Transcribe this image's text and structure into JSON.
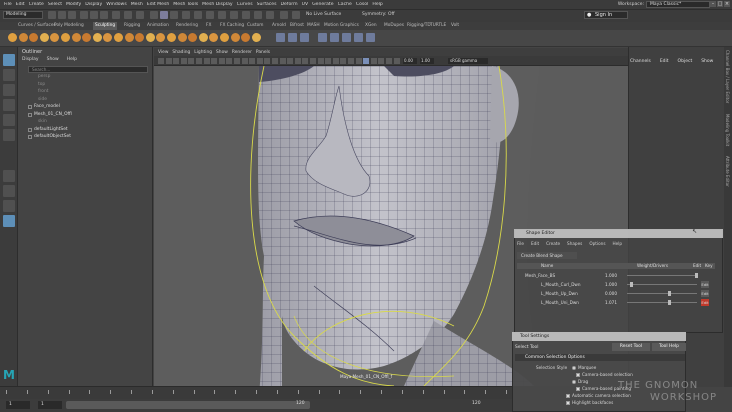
{
  "menubar": {
    "items": [
      "File",
      "Edit",
      "Create",
      "Select",
      "Modify",
      "Display",
      "Windows",
      "Mesh",
      "Edit Mesh",
      "Mesh Tools",
      "Mesh Display",
      "Curves",
      "Surfaces",
      "Deform",
      "UV",
      "Generate",
      "Cache",
      "Cosol",
      "Help"
    ],
    "workspace_label": "Workspace:",
    "workspace_value": "Maya Classic*"
  },
  "statusline": {
    "mode": "Modeling",
    "no_live": "No Live Surface",
    "symmetry": "Symmetry: Off",
    "sign_in": "Sign In"
  },
  "shelf_tabs": [
    "Curves / Surfaces",
    "Poly Modeling",
    "Sculpting",
    "Rigging",
    "Animation",
    "Rendering",
    "FX",
    "FX Caching",
    "Custom",
    "Arnold",
    "Bifrost",
    "MASH",
    "Motion Graphics",
    "XGen",
    "MoDupes",
    "Rigging/TD",
    "TURTLE",
    "Volt"
  ],
  "active_shelf_tab": "Sculpting",
  "outliner": {
    "title": "Outliner",
    "menu": [
      "Display",
      "Show",
      "Help"
    ],
    "search_placeholder": "Search...",
    "items": [
      {
        "label": "persp",
        "dim": true
      },
      {
        "label": "top",
        "dim": true
      },
      {
        "label": "front",
        "dim": true
      },
      {
        "label": "side",
        "dim": true
      },
      {
        "label": "Face_model",
        "dim": false
      },
      {
        "label": "Mesh_01_CN_Offl",
        "dim": false
      },
      {
        "label": "skin",
        "dim": true
      },
      {
        "label": "defaultLightSet",
        "dim": false
      },
      {
        "label": "defaultObjectSet",
        "dim": false
      }
    ]
  },
  "viewport": {
    "menu": [
      "View",
      "Shading",
      "Lighting",
      "Show",
      "Renderer",
      "Panels"
    ],
    "near_clip": "0.00",
    "far_clip": "1.00",
    "color_space": "sRGB gamma",
    "camera_label": "Maya Mesh_01_CN_Offl_f"
  },
  "channel_box": {
    "menu": [
      "Channels",
      "Edit",
      "Object",
      "Show"
    ],
    "side_tabs": [
      "Channel Box / Layer Editor",
      "Modeling Toolkit",
      "Attribute Editor"
    ]
  },
  "shape_editor": {
    "title": "Shape Editor",
    "menu": [
      "File",
      "Edit",
      "Create",
      "Shapes",
      "Options",
      "Help"
    ],
    "create_button": "Create Blend Shape",
    "columns": [
      "Name",
      "",
      "Weight/Drivers",
      "Edit",
      "Key"
    ],
    "rows": [
      {
        "name": "Mesh_Face_BS",
        "value": "1.000",
        "slider": 1.0
      },
      {
        "name": "L_Mouth_Curl_Dwn",
        "value": "1.000",
        "slider": 0.05
      },
      {
        "name": "L_Mouth_Up_Dwn",
        "value": "0.000",
        "slider": 0.6
      },
      {
        "name": "L_Mouth_Uni_Dwn",
        "value": "1.071",
        "slider": 0.6
      }
    ]
  },
  "tool_settings": {
    "title": "Tool Settings",
    "tool_name": "Select Tool",
    "reset_button": "Reset Tool",
    "help_button": "Tool Help",
    "section": "Common Selection Options",
    "selection_style_label": "Selection Style",
    "options": [
      "Marquee",
      "Camera-based selection",
      "Drag",
      "Camera-based painting",
      "Automatic camera selection",
      "Highlight backfaces"
    ]
  },
  "time_slider": {
    "ticks": [
      1,
      5,
      10,
      15,
      20,
      25,
      30,
      35,
      40,
      45,
      50,
      55,
      60,
      65,
      70,
      75,
      80,
      85,
      90,
      95,
      100,
      105,
      110,
      115,
      120
    ],
    "start": "1",
    "in": "1",
    "out": "120",
    "end": "120"
  },
  "watermark": {
    "line1": "THE GNOMON",
    "line2": "WORKSHOP"
  },
  "logo": "M",
  "colors": {
    "accent_blue": "#5d8fb8",
    "maya_teal": "#26a5b5",
    "wire_yellow": "#d9d94a",
    "key_red": "#c0392b"
  }
}
